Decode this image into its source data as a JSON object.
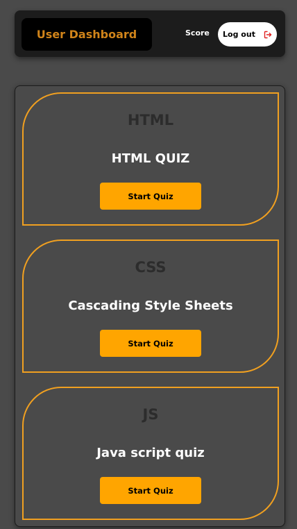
{
  "header": {
    "brand": "User Dashboard",
    "score_label": "Score",
    "logout_label": "Log out",
    "logout_icon": "logout-icon"
  },
  "quizzes": [
    {
      "subject": "HTML",
      "title": "HTML QUIZ",
      "button": "Start Quiz"
    },
    {
      "subject": "CSS",
      "title": "Cascading Style Sheets",
      "button": "Start Quiz"
    },
    {
      "subject": "JS",
      "title": "Java script quiz",
      "button": "Start Quiz"
    }
  ],
  "colors": {
    "accent": "#ffa500",
    "brand_text": "#d0841a",
    "card_border": "#f1a020",
    "background": "#4a4a4a",
    "header_bg": "#1c1c1c",
    "logout_icon": "#e02020"
  }
}
